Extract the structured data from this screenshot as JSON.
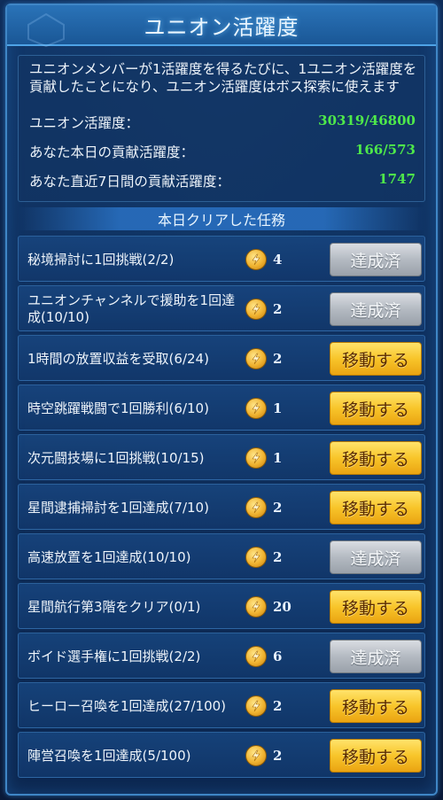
{
  "title": "ユニオン活躍度",
  "info": {
    "description": "ユニオンメンバーが1活躍度を得るたびに、1ユニオン活躍度を貢献したことになり、ユニオン活躍度はボス探索に使えます",
    "stats": [
      {
        "label": "ユニオン活躍度：",
        "value": "30319/46800"
      },
      {
        "label": "あなた本日の貢献活躍度：",
        "value": "166/573"
      },
      {
        "label": "あなた直近7日間の貢献活躍度：",
        "value": "1747"
      }
    ]
  },
  "section_title": "本日クリアした任務",
  "colors": {
    "value_green": "#4ee84a",
    "go_button": "#f8c52a",
    "done_button": "#b4bac2"
  },
  "reward_icon": "lightning-coin-icon",
  "tasks": [
    {
      "name": "秘境掃討に1回挑戦(2/2)",
      "reward": "4",
      "button": "達成済",
      "status": "done"
    },
    {
      "name": "ユニオンチャンネルで援助を1回達成(10/10)",
      "reward": "2",
      "button": "達成済",
      "status": "done"
    },
    {
      "name": "1時間の放置収益を受取(6/24)",
      "reward": "2",
      "button": "移動する",
      "status": "go"
    },
    {
      "name": "時空跳躍戦闘で1回勝利(6/10)",
      "reward": "1",
      "button": "移動する",
      "status": "go"
    },
    {
      "name": "次元闘技場に1回挑戦(10/15)",
      "reward": "1",
      "button": "移動する",
      "status": "go"
    },
    {
      "name": "星間逮捕掃討を1回達成(7/10)",
      "reward": "2",
      "button": "移動する",
      "status": "go"
    },
    {
      "name": "高速放置を1回達成(10/10)",
      "reward": "2",
      "button": "達成済",
      "status": "done"
    },
    {
      "name": "星間航行第3階をクリア(0/1)",
      "reward": "20",
      "button": "移動する",
      "status": "go"
    },
    {
      "name": "ボイド選手権に1回挑戦(2/2)",
      "reward": "6",
      "button": "達成済",
      "status": "done"
    },
    {
      "name": "ヒーロー召喚を1回達成(27/100)",
      "reward": "2",
      "button": "移動する",
      "status": "go"
    },
    {
      "name": "陣営召喚を1回達成(5/100)",
      "reward": "2",
      "button": "移動する",
      "status": "go"
    }
  ]
}
